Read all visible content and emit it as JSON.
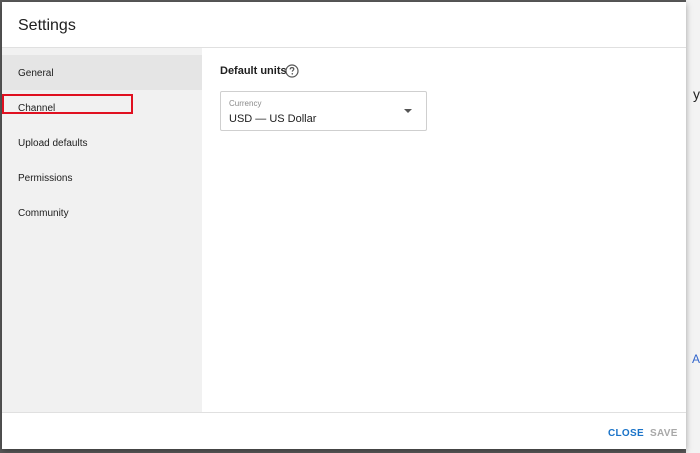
{
  "dialog": {
    "title": "Settings"
  },
  "sidebar": {
    "items": [
      {
        "label": "General",
        "selected": true
      },
      {
        "label": "Channel",
        "selected": false,
        "highlighted": true
      },
      {
        "label": "Upload defaults",
        "selected": false
      },
      {
        "label": "Permissions",
        "selected": false
      },
      {
        "label": "Community",
        "selected": false
      }
    ]
  },
  "general": {
    "section_title": "Default units",
    "help_icon": "question-circle-icon",
    "currency": {
      "caption": "Currency",
      "value": "USD — US Dollar"
    }
  },
  "footer": {
    "close_label": "CLOSE",
    "save_label": "SAVE"
  },
  "backdrop": {
    "edge_glyph_top": "y",
    "edge_glyph_bottom": "A"
  },
  "colors": {
    "accent": "#1a73c8",
    "highlight_border": "#e01020",
    "disabled": "#a8a8a8"
  }
}
